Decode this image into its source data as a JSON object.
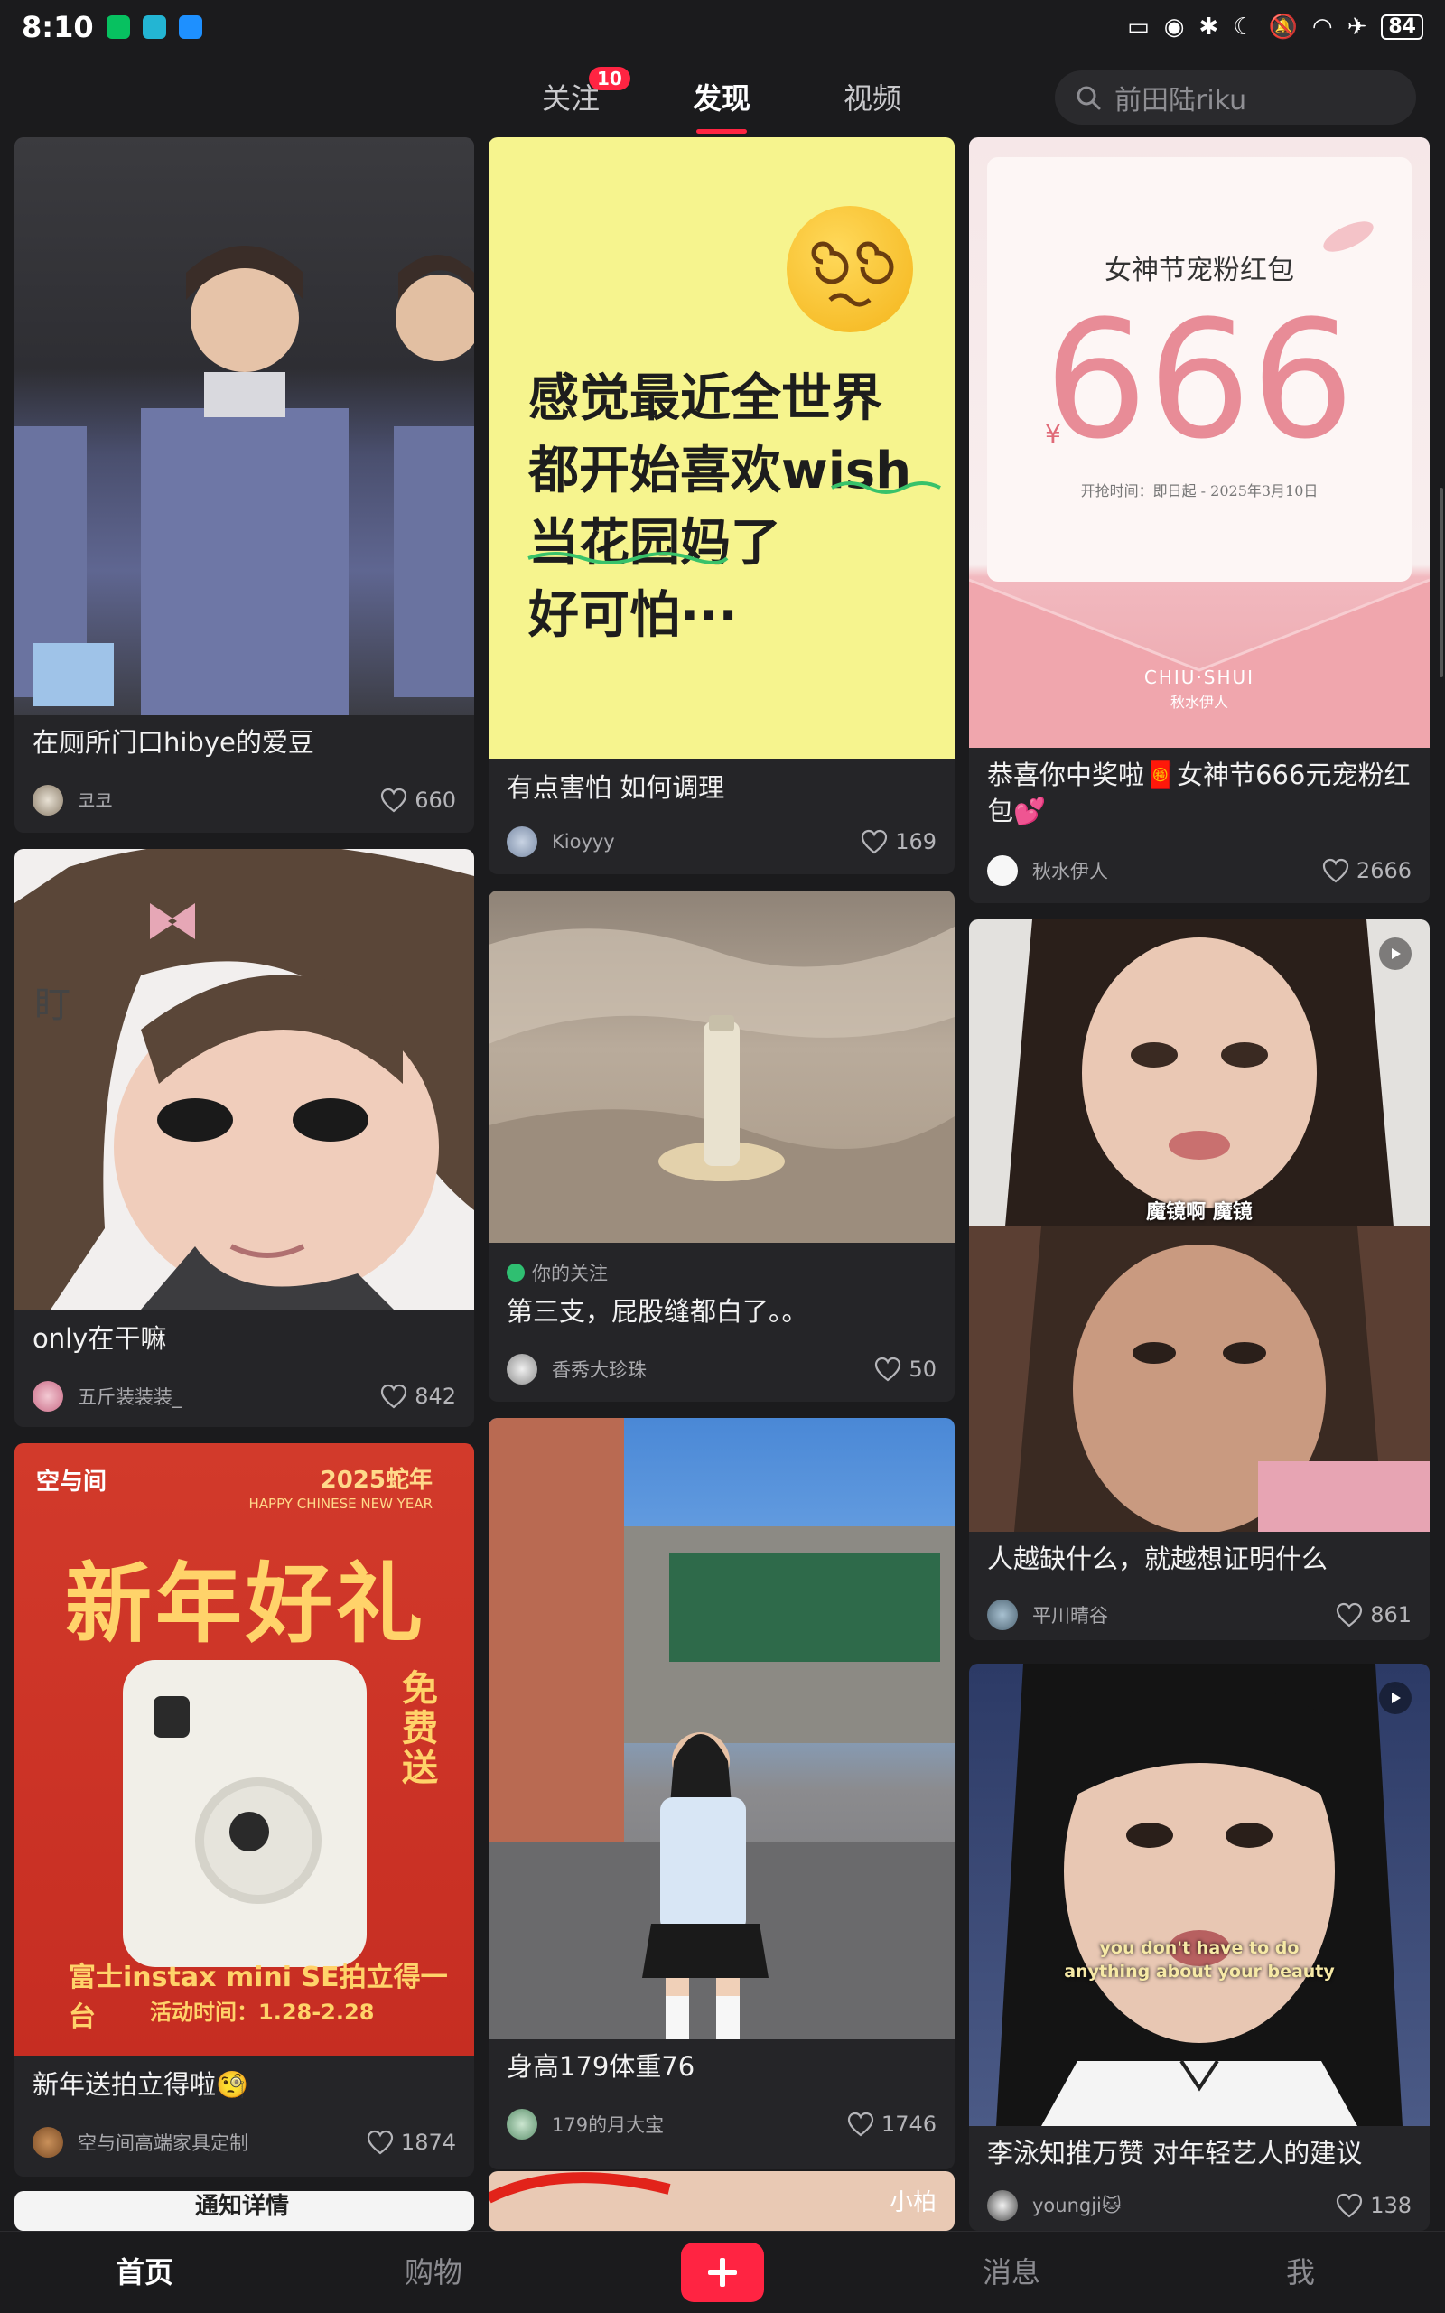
{
  "status_bar": {
    "time": "8:10",
    "battery": "84"
  },
  "top_nav": {
    "tabs": [
      {
        "label": "关注",
        "badge": "10"
      },
      {
        "label": "发现"
      },
      {
        "label": "视频"
      }
    ],
    "search_placeholder": "前田陆riku"
  },
  "cards": [
    {
      "title": "在厕所门口hibye的爱豆",
      "author": "코코",
      "likes": "660"
    },
    {
      "title": "有点害怕 如何调理",
      "author": "Kioyyy",
      "likes": "169",
      "thumb_text": [
        "感觉最近全世界",
        "都开始喜欢wish",
        "当花园妈了",
        "好可怕···"
      ]
    },
    {
      "title": "恭喜你中奖啦🧧女神节666元宠粉红包💕",
      "author": "秋水伊人",
      "likes": "2666",
      "thumb_text": {
        "heading": "女神节宠粉红包",
        "amount": "666",
        "currency": "¥",
        "period": "开抢时间：即日起 - 2025年3月10日",
        "brand": "CHIU·SHUI",
        "brand_cn": "秋水伊人"
      }
    },
    {
      "title": "only在干嘛",
      "author": "五斤装装装_",
      "likes": "842",
      "thumb_text": "盯"
    },
    {
      "tag": "你的关注",
      "title": "第三支，屁股缝都白了。。",
      "author": "香秀大珍珠",
      "likes": "50"
    },
    {
      "title": "人越缺什么，就越想证明什么",
      "author": "平川晴谷",
      "likes": "861",
      "caption": "魔镜啊 魔镜"
    },
    {
      "title": "新年送拍立得啦🧐",
      "author": "空与间高端家具定制",
      "likes": "1874",
      "thumb_text": {
        "brand": "空与间",
        "year": "2025蛇年",
        "greeting": "HAPPY CHINESE NEW YEAR",
        "headline": "新年好礼",
        "side": "免费送",
        "product": "富士instax mini SE拍立得一台",
        "period": "活动时间：1.28-2.28"
      }
    },
    {
      "title": "身高179体重76",
      "author": "179的月大宝",
      "likes": "1746"
    },
    {
      "title": "李泳知推万赞 对年轻艺人的建议",
      "author": "youngji🐱",
      "likes": "138",
      "caption": [
        "you don't have to do",
        "anything about your beauty"
      ]
    }
  ],
  "partial_cards": {
    "left_text": "通知详情",
    "center_text": "小柏"
  },
  "bottom_nav": {
    "home": "首页",
    "shop": "购物",
    "messages": "消息",
    "me": "我"
  }
}
